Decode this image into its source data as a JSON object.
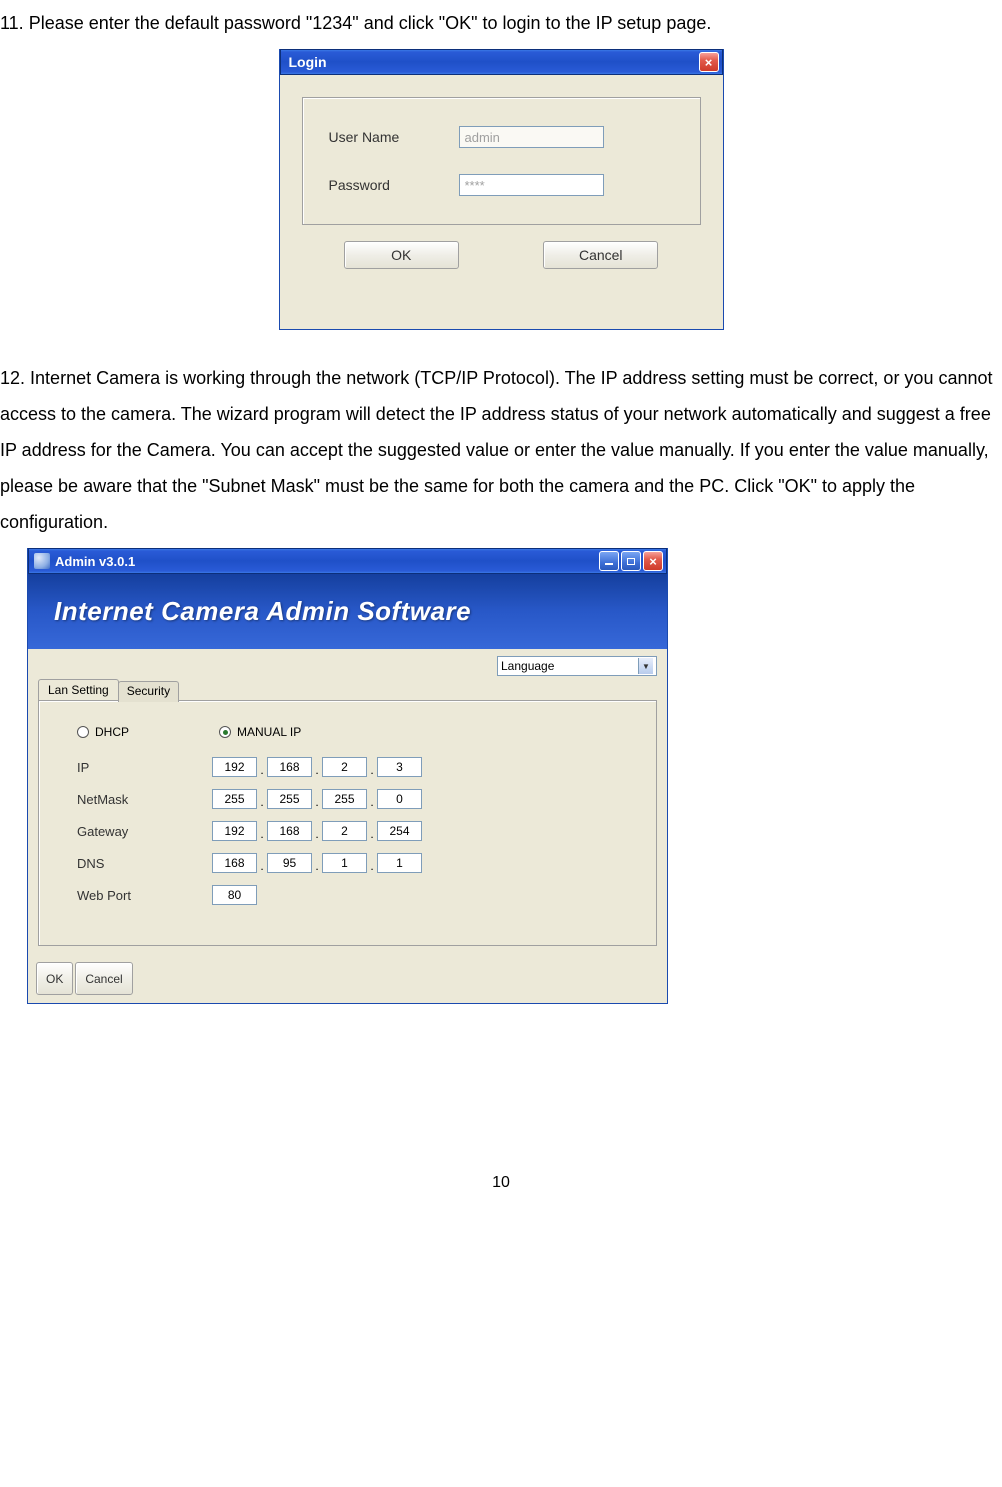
{
  "step11": {
    "num": "11.",
    "text": "Please enter the default password \"1234\" and click \"OK\" to login to the IP setup page."
  },
  "login": {
    "title": "Login",
    "close": "×",
    "username_label": "User Name",
    "username_value": "admin",
    "password_label": "Password",
    "password_value": "****",
    "ok": "OK",
    "cancel": "Cancel"
  },
  "step12": {
    "num": "12.",
    "text": "Internet Camera is working through the network (TCP/IP Protocol). The IP address setting must be correct, or you cannot access to the camera. The wizard program will detect the IP address status of your network automatically and suggest a free IP address for the Camera. You can accept the suggested value or enter the value manually. If you enter the value manually, please be aware that the \"Subnet Mask\" must be the same for both the camera and the PC. Click \"OK\" to apply the configuration."
  },
  "admin": {
    "title": "Admin v3.0.1",
    "banner": "Internet Camera Admin Software",
    "language_label": "Language",
    "tabs": {
      "lan": "Lan Setting",
      "security": "Security"
    },
    "radio": {
      "dhcp": "DHCP",
      "manual": "MANUAL IP"
    },
    "rows": {
      "ip": {
        "label": "IP",
        "o1": "192",
        "o2": "168",
        "o3": "2",
        "o4": "3"
      },
      "netmask": {
        "label": "NetMask",
        "o1": "255",
        "o2": "255",
        "o3": "255",
        "o4": "0"
      },
      "gateway": {
        "label": "Gateway",
        "o1": "192",
        "o2": "168",
        "o3": "2",
        "o4": "254"
      },
      "dns": {
        "label": "DNS",
        "o1": "168",
        "o2": "95",
        "o3": "1",
        "o4": "1"
      },
      "webport": {
        "label": "Web Port",
        "value": "80"
      }
    },
    "footer": {
      "ok": "OK",
      "cancel": "Cancel"
    }
  },
  "page_number": "10"
}
